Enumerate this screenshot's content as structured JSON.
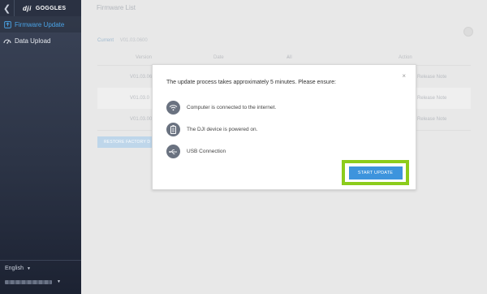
{
  "sidebar": {
    "back_icon": "chevron-left-icon",
    "brand_logo": "dji",
    "brand_title": "GOGGLES",
    "items": [
      {
        "label": "Firmware Update",
        "icon": "firmware-update-icon",
        "active": true
      },
      {
        "label": "Data Upload",
        "icon": "data-upload-icon",
        "active": false
      }
    ],
    "language": "English",
    "accent_color": "#4aa3e6"
  },
  "main": {
    "title": "Firmware List",
    "current_label": "Current",
    "current_version": "V01.03.0600",
    "table": {
      "headers": [
        "Version",
        "Date",
        "All",
        "Action"
      ],
      "rows": [
        {
          "version": "V01.03.06",
          "action": "Release Note"
        },
        {
          "version": "V01.03.0",
          "action": "Release Note"
        },
        {
          "version": "V01.03.00",
          "action": "Release Note"
        }
      ]
    },
    "restore_label": "RESTORE FACTORY D"
  },
  "modal": {
    "close_icon": "close-icon",
    "title": "The update process takes approximately 5 minutes. Please ensure:",
    "items": [
      {
        "icon": "wifi-icon",
        "text": "Computer is connected to the internet."
      },
      {
        "icon": "battery-icon",
        "text": "The DJI device is powered on."
      },
      {
        "icon": "usb-icon",
        "text": "USB Connection"
      }
    ],
    "start_label": "START UPDATE",
    "highlight_color": "#8ccc1c",
    "button_color": "#3d94dd"
  }
}
